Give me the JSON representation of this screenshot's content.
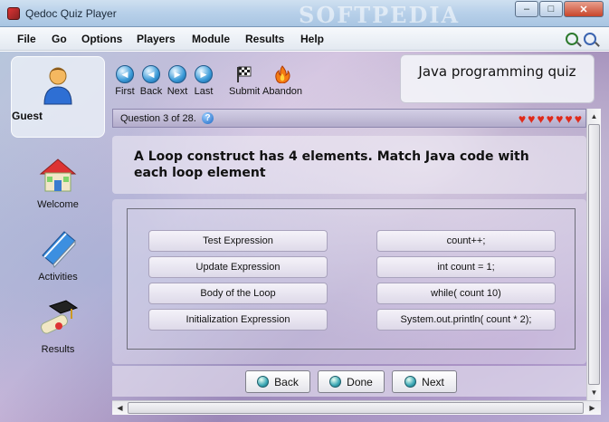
{
  "window": {
    "title": "Qedoc Quiz Player",
    "watermark": "SOFTPEDIA"
  },
  "menu": [
    "File",
    "Go",
    "Options",
    "Players",
    "Module",
    "Results",
    "Help"
  ],
  "zoom_icons": [
    "zoom-in-icon",
    "zoom-out-icon"
  ],
  "sidebar": {
    "user": {
      "label": "Guest",
      "icon": "user-icon"
    },
    "items": [
      {
        "label": "Welcome",
        "icon": "house-icon"
      },
      {
        "label": "Activities",
        "icon": "book-icon"
      },
      {
        "label": "Results",
        "icon": "diploma-icon"
      }
    ]
  },
  "nav": {
    "buttons": [
      {
        "label": "First",
        "icon": "first-icon"
      },
      {
        "label": "Back",
        "icon": "back-icon"
      },
      {
        "label": "Next",
        "icon": "next-icon"
      },
      {
        "label": "Last",
        "icon": "last-icon"
      }
    ],
    "submit": "Submit",
    "abandon": "Abandon"
  },
  "quiz_title": "Java programming quiz",
  "question_bar": {
    "text": "Question 3 of 28.",
    "lives": 7,
    "lives_icon": "heart-icon"
  },
  "question_text": "A Loop construct has 4 elements. Match Java code with each loop element",
  "left_items": [
    "Test Expression",
    "Update Expression",
    "Body of the Loop",
    "Initialization Expression"
  ],
  "right_items": [
    "count++;",
    "int count = 1;",
    "while( count 10)",
    "System.out.println( count * 2);"
  ],
  "actions": {
    "back": "Back",
    "done": "Done",
    "next": "Next"
  },
  "colors": {
    "title_bar": "#b9d1ea",
    "heart": "#e02a1a",
    "nav_circle": "#3a9ad8"
  }
}
